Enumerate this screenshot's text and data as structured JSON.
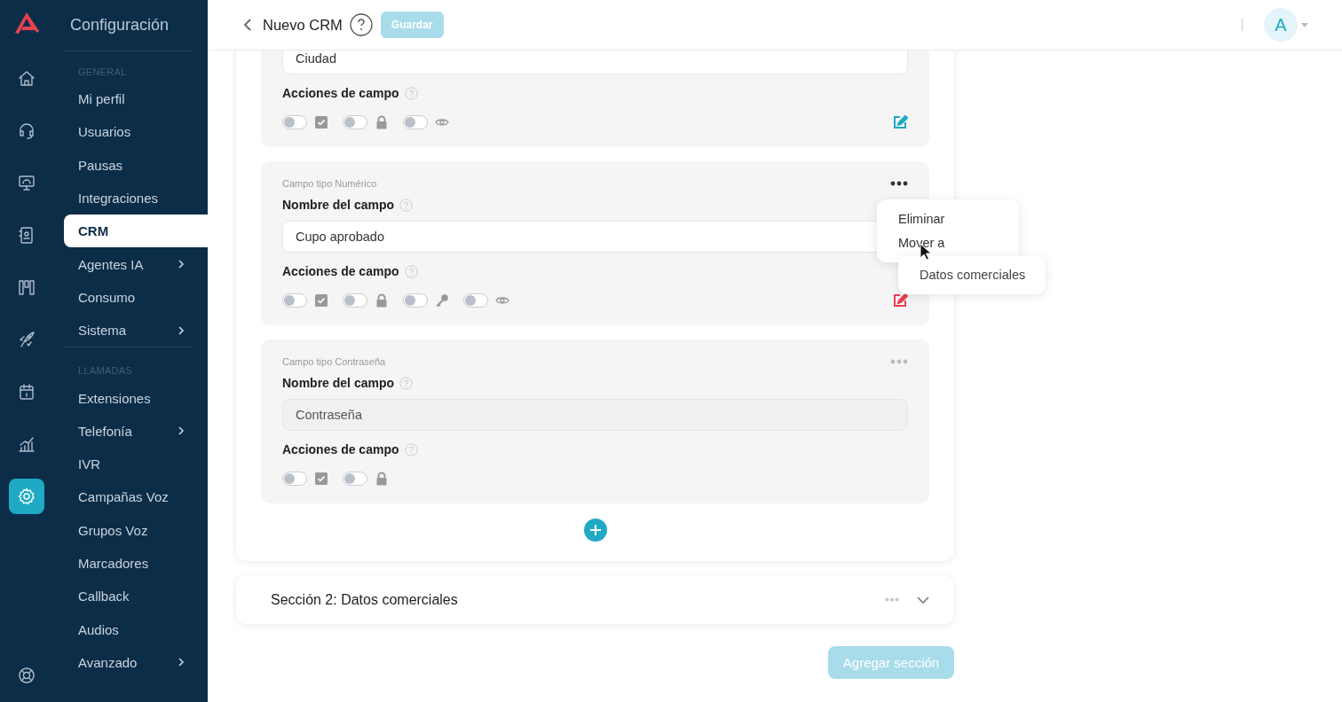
{
  "rail": {
    "items": [
      {
        "kind": "home",
        "selected": false
      },
      {
        "kind": "headset",
        "selected": false
      },
      {
        "kind": "monitor",
        "selected": false
      },
      {
        "kind": "contact",
        "selected": false
      },
      {
        "kind": "board",
        "selected": false
      },
      {
        "kind": "rocket",
        "selected": false
      },
      {
        "kind": "calendar",
        "selected": false
      },
      {
        "kind": "chart",
        "selected": false
      },
      {
        "kind": "settings",
        "selected": true
      }
    ],
    "bottom": [
      {
        "kind": "lifebuoy",
        "selected": false
      }
    ]
  },
  "sidebar": {
    "title": "Configuración",
    "groups": [
      {
        "heading": "GENERAL",
        "items": [
          {
            "label": "Mi perfil",
            "selected": false,
            "has_submenu": false
          },
          {
            "label": "Usuarios",
            "selected": false,
            "has_submenu": false
          },
          {
            "label": "Pausas",
            "selected": false,
            "has_submenu": false
          },
          {
            "label": "Integraciones",
            "selected": false,
            "has_submenu": false
          },
          {
            "label": "CRM",
            "selected": true,
            "has_submenu": false
          },
          {
            "label": "Agentes IA",
            "selected": false,
            "has_submenu": true
          },
          {
            "label": "Consumo",
            "selected": false,
            "has_submenu": false
          },
          {
            "label": "Sistema",
            "selected": false,
            "has_submenu": true
          }
        ]
      },
      {
        "heading": "LLAMADAS",
        "items": [
          {
            "label": "Extensiones",
            "selected": false,
            "has_submenu": false
          },
          {
            "label": "Telefonía",
            "selected": false,
            "has_submenu": true
          },
          {
            "label": "IVR",
            "selected": false,
            "has_submenu": false
          },
          {
            "label": "Campañas Voz",
            "selected": false,
            "has_submenu": false
          },
          {
            "label": "Grupos Voz",
            "selected": false,
            "has_submenu": false
          },
          {
            "label": "Marcadores",
            "selected": false,
            "has_submenu": false
          },
          {
            "label": "Callback",
            "selected": false,
            "has_submenu": false
          },
          {
            "label": "Audios",
            "selected": false,
            "has_submenu": false
          },
          {
            "label": "Avanzado",
            "selected": false,
            "has_submenu": true
          }
        ]
      }
    ]
  },
  "header": {
    "title": "Nuevo CRM",
    "save_button": {
      "label": "Guardar",
      "disabled": true
    },
    "avatar": "A"
  },
  "fields": [
    {
      "value": "Ciudad",
      "disabled": false,
      "actions_label": "Acciones de campo",
      "color": "#1fa9c4",
      "actions": [
        {
          "kind": "required",
          "on": false
        },
        {
          "kind": "locked",
          "on": false
        },
        {
          "kind": "visible",
          "on": false
        }
      ]
    },
    {
      "type_label": "Campo tipo Numérico",
      "name_label": "Nombre del campo",
      "value": "Cupo aprobado",
      "disabled": false,
      "actions_label": "Acciones de campo",
      "color": "#e8414f",
      "menu_open": true,
      "actions": [
        {
          "kind": "required",
          "on": false
        },
        {
          "kind": "locked",
          "on": false
        },
        {
          "kind": "key",
          "on": false
        },
        {
          "kind": "visible",
          "on": false
        }
      ]
    },
    {
      "type_label": "Campo tipo Contraseña",
      "name_label": "Nombre del campo",
      "value": "Contraseña",
      "disabled": true,
      "actions_label": "Acciones de campo",
      "menu_open": false,
      "actions": [
        {
          "kind": "required",
          "on": false
        },
        {
          "kind": "locked",
          "on": false
        }
      ]
    }
  ],
  "context_menu": {
    "items": [
      "Eliminar",
      "Mover a"
    ],
    "submenu": [
      "Datos comerciales"
    ]
  },
  "sections": [
    {
      "title": "Sección 2: Datos comerciales",
      "expanded": false
    }
  ],
  "add_section_button": {
    "label": "Agregar sección",
    "disabled": true
  }
}
